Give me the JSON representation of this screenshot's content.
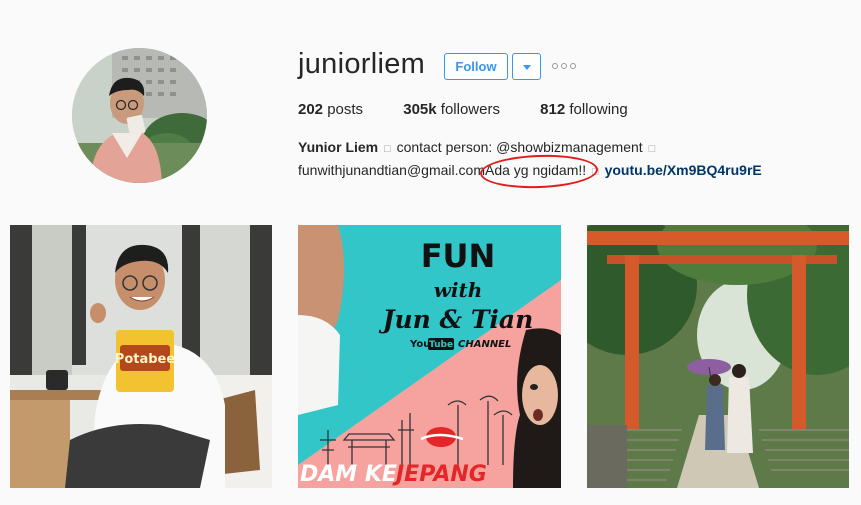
{
  "profile": {
    "username": "juniorliem",
    "follow_label": "Follow"
  },
  "stats": {
    "posts_count": "202",
    "posts_label": "posts",
    "followers_count": "305k",
    "followers_label": "followers",
    "following_count": "812",
    "following_label": "following"
  },
  "bio": {
    "name": "Yunior Liem",
    "line1_text": "contact person: @showbizmanagement",
    "email": "funwithjunandtian@gmail.com",
    "highlight": "Ada yg ngidam!!",
    "link": "youtu.be/Xm9BQ4ru9rE",
    "glyph": "□"
  },
  "posts": [
    {
      "id": "post-1",
      "caption": "Potabee"
    },
    {
      "id": "post-2",
      "title_line1": "FUN",
      "title_line2": "with",
      "title_line3": "Jun & Tian",
      "youtube_you": "You",
      "youtube_tube": "Tube",
      "channel": "CHANNEL",
      "banner_left": "DAM KE ",
      "banner_right": "JEPANG"
    },
    {
      "id": "post-3"
    }
  ],
  "colors": {
    "accent": "#3897f0",
    "link": "#003569",
    "highlight_ring": "#e11c1c",
    "teal": "#33c6c8",
    "pink": "#f6a3a0",
    "red_text": "#e52628"
  }
}
